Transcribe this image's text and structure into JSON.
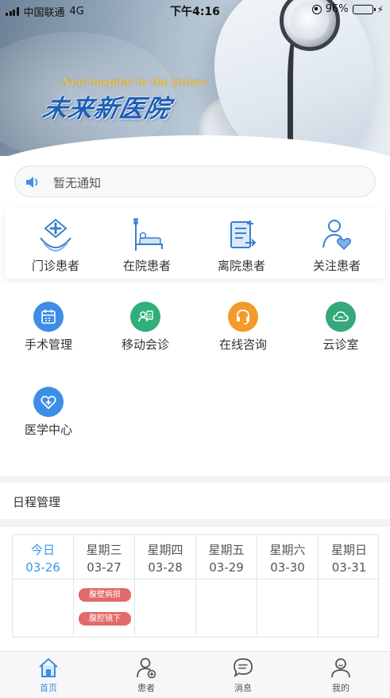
{
  "status_bar": {
    "carrier": "中国联通",
    "network": "4G",
    "time": "下午4:16",
    "battery": "96%",
    "battery_level": 0.96
  },
  "banner": {
    "subtitle_en": "New hospital in the future",
    "title_cn": "未来新医院"
  },
  "notice": {
    "text": "暂无通知",
    "icon": "speaker-icon"
  },
  "patient_types": [
    {
      "label": "门诊患者",
      "icon": "outpatient-icon"
    },
    {
      "label": "在院患者",
      "icon": "inpatient-bed-icon"
    },
    {
      "label": "离院患者",
      "icon": "discharge-icon"
    },
    {
      "label": "关注患者",
      "icon": "followed-patient-icon"
    }
  ],
  "services": [
    {
      "label": "手术管理",
      "icon": "surgery-calendar-icon",
      "color": "#3d8ee8"
    },
    {
      "label": "移动会诊",
      "icon": "consultation-icon",
      "color": "#2fb07a"
    },
    {
      "label": "在线咨询",
      "icon": "headset-icon",
      "color": "#f39a2a"
    },
    {
      "label": "云诊室",
      "icon": "cloud-clinic-icon",
      "color": "#35a97a"
    },
    {
      "label": "医学中心",
      "icon": "medical-center-icon",
      "color": "#3d8ee8"
    }
  ],
  "schedule": {
    "title": "日程管理",
    "days": [
      {
        "weekday": "今日",
        "date": "03-26",
        "today": true,
        "events": []
      },
      {
        "weekday": "星期三",
        "date": "03-27",
        "today": false,
        "events": [
          "腹壁病损",
          "腹腔镜下"
        ]
      },
      {
        "weekday": "星期四",
        "date": "03-28",
        "today": false,
        "events": []
      },
      {
        "weekday": "星期五",
        "date": "03-29",
        "today": false,
        "events": []
      },
      {
        "weekday": "星期六",
        "date": "03-30",
        "today": false,
        "events": []
      },
      {
        "weekday": "星期日",
        "date": "03-31",
        "today": false,
        "events": []
      }
    ],
    "event_color": "#e26a6a",
    "today_color": "#3a95e8"
  },
  "tabbar": [
    {
      "label": "首页",
      "icon": "home-icon",
      "active": true
    },
    {
      "label": "患者",
      "icon": "patient-icon",
      "active": false
    },
    {
      "label": "消息",
      "icon": "message-icon",
      "active": false
    },
    {
      "label": "我的",
      "icon": "profile-icon",
      "active": false
    }
  ],
  "colors": {
    "accent": "#3a8ee6",
    "icon_line": "#3a7fd0"
  }
}
